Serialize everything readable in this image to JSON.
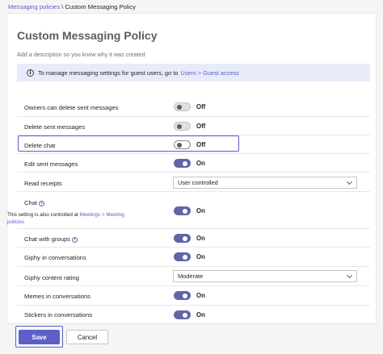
{
  "breadcrumb": {
    "parent": "Messaging policies",
    "separator": " \\ ",
    "current": "Custom Messaging Policy"
  },
  "page": {
    "title": "Custom Messaging Policy",
    "description_placeholder": "Add a description so you know why it was created"
  },
  "banner": {
    "text": "To manage messaging settings for guest users, go to",
    "link": "Users > Guest access"
  },
  "settings": {
    "owners_delete": {
      "label": "Owners can delete sent messages",
      "state": "Off"
    },
    "delete_sent": {
      "label": "Delete sent messages",
      "state": "Off"
    },
    "delete_chat": {
      "label": "Delete chat",
      "state": "Off"
    },
    "edit_sent": {
      "label": "Edit sent messages",
      "state": "On"
    },
    "read_receipts": {
      "label": "Read receipts",
      "value": "User controlled"
    },
    "chat": {
      "label": "Chat",
      "note_prefix": "This setting is also controlled at",
      "note_link": "Meetings > Meeting",
      "note_suffix": "policies",
      "state": "On"
    },
    "chat_groups": {
      "label": "Chat with groups",
      "state": "On"
    },
    "giphy": {
      "label": "Giphy in conversations",
      "state": "On"
    },
    "giphy_rating": {
      "label": "Giphy content rating",
      "value": "Moderate"
    },
    "memes": {
      "label": "Memes in conversations",
      "state": "On"
    },
    "stickers": {
      "label": "Stickers in conversations",
      "state": "On"
    }
  },
  "footer": {
    "save": "Save",
    "cancel": "Cancel"
  },
  "colors": {
    "accent": "#5b5fc7",
    "toggle_on": "#6264a7",
    "banner_bg": "#e8ebfa"
  }
}
